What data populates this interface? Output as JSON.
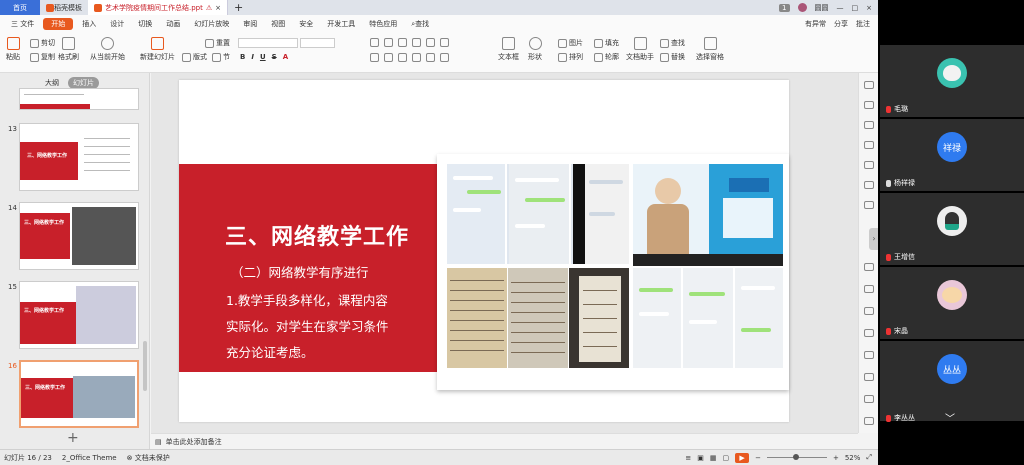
{
  "tabs": {
    "home": "首页",
    "template": "稻壳模板",
    "document": "艺术学院疫情期间工作总结.ppt",
    "add": "+",
    "user": "圆圆",
    "badge": "1"
  },
  "menu": {
    "file": "三 文件",
    "items": [
      "开始",
      "插入",
      "设计",
      "切换",
      "动画",
      "幻灯片放映",
      "审阅",
      "视图",
      "安全",
      "开发工具",
      "特色应用"
    ],
    "active": "开始",
    "search": "查找",
    "right": [
      "有异常",
      "分享",
      "批注"
    ]
  },
  "ribbon": {
    "paste": "粘贴",
    "cut": "剪切",
    "copy": "复制",
    "format_painter": "格式刷",
    "from_current": "从当前开始",
    "new_slide": "新建幻灯片",
    "layout": "版式",
    "section": "节",
    "reset": "重置",
    "textbox": "文本框",
    "shape": "形状",
    "arrange": "排列",
    "picture": "图片",
    "fill": "填充",
    "outline": "轮廓",
    "find": "查找",
    "replace": "替换",
    "text_assistant": "文档助手",
    "select_pane": "选择窗格"
  },
  "left_panel": {
    "outline_tab": "大纲",
    "slides_tab": "幻灯片",
    "thumbs": [
      {
        "num": "13",
        "title": "三、网络教学工作"
      },
      {
        "num": "14",
        "title": "三、网络教学工作"
      },
      {
        "num": "15",
        "title": "三、网络教学工作"
      },
      {
        "num": "16",
        "title": "三、网络教学工作"
      }
    ],
    "add": "+"
  },
  "slide": {
    "title": "三、网络教学工作",
    "subtitle": "（二）网络教学有序进行",
    "body": [
      "1.教学手段多样化，课程内容",
      "实际化。对学生在家学习条件",
      "充分论证考虑。"
    ]
  },
  "notes": {
    "placeholder": "单击此处添加备注"
  },
  "status": {
    "slide_count": "幻灯片 16 / 23",
    "theme": "2_Office Theme",
    "protect": "文档未保护",
    "zoom": "52%"
  },
  "meeting": {
    "participants": [
      {
        "name": "毛璐",
        "avatar": "",
        "mic": "off"
      },
      {
        "name": "杨祥禄",
        "avatar": "祥禄",
        "mic": "on"
      },
      {
        "name": "王增信",
        "avatar": "",
        "mic": "off"
      },
      {
        "name": "宋晶",
        "avatar": "",
        "mic": "off"
      },
      {
        "name": "李丛丛",
        "avatar": "丛丛",
        "mic": "off"
      }
    ]
  },
  "colors": {
    "accent": "#e8591f",
    "slide_red": "#c8202a",
    "wps_blue": "#3a6fd8",
    "avatar_blue": "#2f7bf0"
  }
}
